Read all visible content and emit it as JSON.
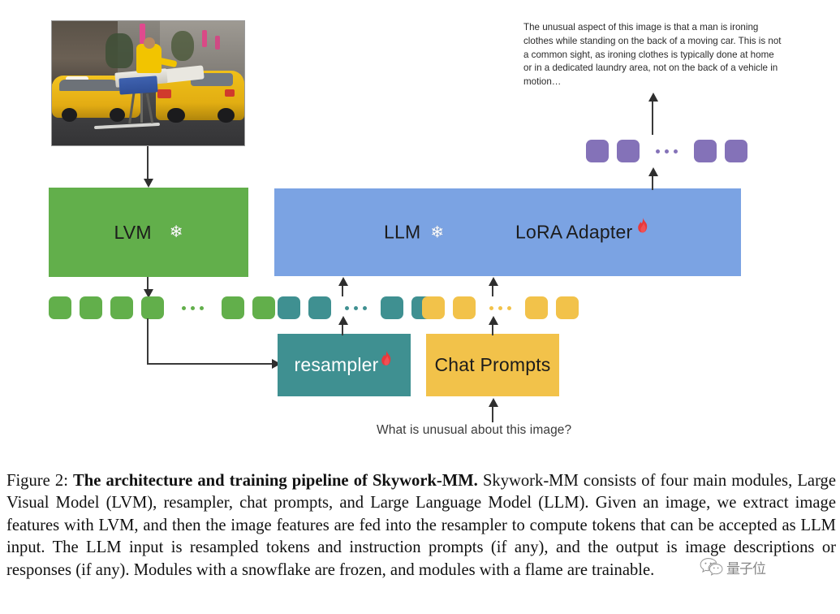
{
  "figure": {
    "photo": {
      "alt_name": "man-ironing-on-car-photo"
    },
    "blocks": {
      "lvm": {
        "label": "LVM",
        "icon": "snowflake-icon",
        "color": "#62AF4B"
      },
      "llm": {
        "label": "LLM",
        "icon": "snowflake-icon",
        "color": "#7BA3E3"
      },
      "lora": {
        "label": "LoRA Adapter",
        "icon": "flame-icon"
      },
      "resampler": {
        "label": "resampler",
        "icon": "flame-icon",
        "color": "#3F9091"
      },
      "chat_prompts": {
        "label": "Chat Prompts",
        "color": "#F2C24A"
      }
    },
    "tokens": {
      "image_features": {
        "color": "#62AF4B",
        "left_count": 4,
        "right_count": 2,
        "ellipsis": "..."
      },
      "resampled_tokens": {
        "color": "#3F9091",
        "left_count": 2,
        "right_count": 2,
        "ellipsis": "..."
      },
      "prompt_tokens": {
        "color": "#F2C24A",
        "left_count": 2,
        "right_count": 2,
        "ellipsis": "..."
      },
      "output_tokens": {
        "color": "#8472B8",
        "left_count": 2,
        "right_count": 2,
        "ellipsis": "..."
      }
    },
    "output_text": "The unusual aspect of this image is that a man is ironing clothes while standing on the back of a moving car. This is not a common sight, as ironing clothes is typically done at home or in a dedicated laundry area, not on the back of a vehicle in motion…",
    "question_text": "What is unusual about this image?"
  },
  "caption": {
    "figure_number": "Figure 2:",
    "bold_title": "The architecture and training pipeline of Skywork-MM.",
    "body": " Skywork-MM consists of four main modules, Large Visual Model (LVM), resampler, chat prompts, and Large Language Model (LLM). Given an image, we extract image features with LVM, and then the image features are fed into the resampler to compute tokens that can be accepted as LLM input. The LLM input is resampled tokens and instruction prompts (if any), and the output is image descriptions or responses (if any). Modules with a snowflake are frozen, and modules with a flame are trainable."
  },
  "watermark": {
    "text": "量子位",
    "logo": "wechat-icon"
  }
}
